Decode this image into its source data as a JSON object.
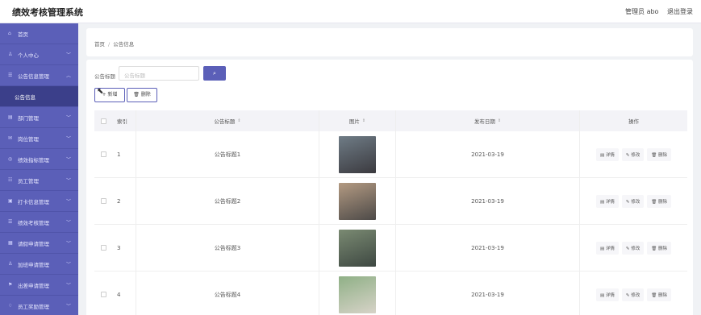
{
  "app": {
    "title": "绩效考核管理系统"
  },
  "header": {
    "user": "管理员 abo",
    "logout": "退出登录"
  },
  "sidebar": {
    "items": [
      {
        "label": "首页",
        "icon": "home-icon",
        "glyph": "⌂",
        "expandable": false
      },
      {
        "label": "个人中心",
        "icon": "user-icon",
        "glyph": "♙",
        "expandable": true
      },
      {
        "label": "公告信息管理",
        "icon": "list-icon",
        "glyph": "☰",
        "expandable": true,
        "expanded": true
      },
      {
        "label": "公告信息",
        "sub": true
      },
      {
        "label": "部门管理",
        "icon": "department-icon",
        "glyph": "▤",
        "expandable": true
      },
      {
        "label": "岗位管理",
        "icon": "post-icon",
        "glyph": "✉",
        "expandable": true
      },
      {
        "label": "绩效指标管理",
        "icon": "target-icon",
        "glyph": "◎",
        "expandable": true
      },
      {
        "label": "员工管理",
        "icon": "staff-icon",
        "glyph": "☷",
        "expandable": true
      },
      {
        "label": "打卡信息管理",
        "icon": "clock-icon",
        "glyph": "▣",
        "expandable": true
      },
      {
        "label": "绩效考核管理",
        "icon": "evaluation-icon",
        "glyph": "☰",
        "expandable": true
      },
      {
        "label": "请假申请管理",
        "icon": "leave-icon",
        "glyph": "▦",
        "expandable": true
      },
      {
        "label": "加班申请管理",
        "icon": "overtime-icon",
        "glyph": "♙",
        "expandable": true
      },
      {
        "label": "出差申请管理",
        "icon": "flag-icon",
        "glyph": "⚑",
        "expandable": true
      },
      {
        "label": "员工奖励管理",
        "icon": "reward-icon",
        "glyph": "♢",
        "expandable": true
      }
    ]
  },
  "breadcrumb": {
    "home": "首页",
    "current": "公告信息"
  },
  "search": {
    "label": "公告标题",
    "placeholder": "公告标题",
    "button_icon": "search-icon"
  },
  "actions": {
    "add": "新增",
    "delete": "删除"
  },
  "table": {
    "headers": {
      "index": "索引",
      "title": "公告标题",
      "image": "图片",
      "date": "发布日期",
      "ops": "操作"
    },
    "rows": [
      {
        "index": "1",
        "title": "公告标题1",
        "date": "2021-03-19",
        "photo_colors": [
          "#6f7c86",
          "#3b3a3f"
        ]
      },
      {
        "index": "2",
        "title": "公告标题2",
        "date": "2021-03-19",
        "photo_colors": [
          "#b39a82",
          "#4d4a48"
        ]
      },
      {
        "index": "3",
        "title": "公告标题3",
        "date": "2021-03-19",
        "photo_colors": [
          "#7a8a72",
          "#3e4842"
        ]
      },
      {
        "index": "4",
        "title": "公告标题4",
        "date": "2021-03-19",
        "photo_colors": [
          "#8fb086",
          "#d7d3c8"
        ]
      }
    ],
    "op_labels": {
      "detail": "详情",
      "edit": "修改",
      "delete": "删除"
    }
  },
  "colors": {
    "accent": "#5b5fb8",
    "sidebar_active": "#3b3f8a"
  }
}
